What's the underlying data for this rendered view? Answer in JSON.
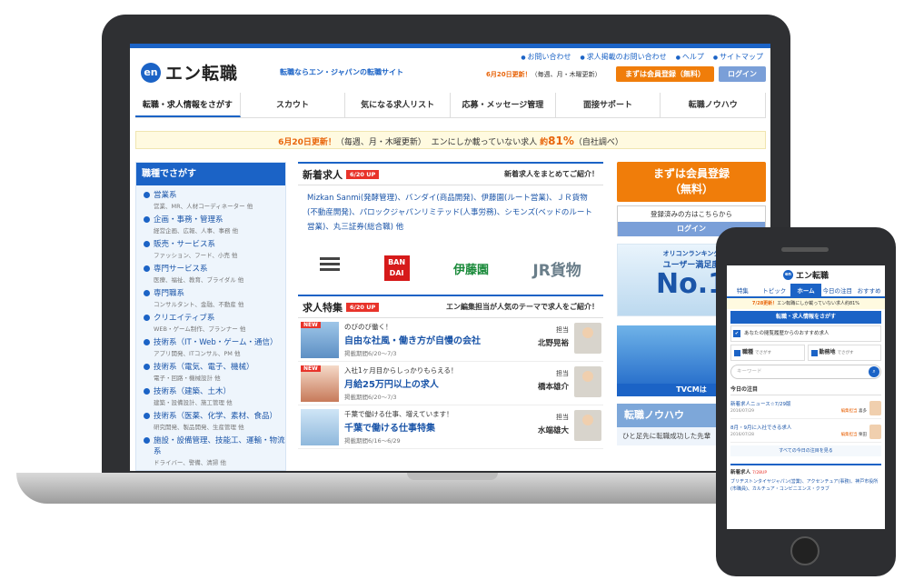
{
  "site": {
    "logo_badge": "en",
    "logo_word": "エン転職",
    "tagline": "転職ならエン・ジャパンの転職サイト",
    "toplinks": [
      "お問い合わせ",
      "求人掲載のお問い合わせ",
      "ヘルプ",
      "サイトマップ"
    ],
    "update_highlight": "6月20日更新！",
    "update_schedule": "（毎週、月・木曜更新）",
    "register_label": "まずは会員登録（無料）",
    "login_label": "ログイン"
  },
  "nav": [
    "転職・求人情報をさがす",
    "スカウト",
    "気になる求人リスト",
    "応募・メッセージ管理",
    "面接サポート",
    "転職ノウハウ"
  ],
  "notice": {
    "highlight": "6月20日更新！",
    "schedule": "（毎週、月・木曜更新）",
    "text": "エンにしか載っていない求人",
    "pct_label": "約",
    "pct": "81%",
    "source": "（自社調べ）"
  },
  "sidebar": {
    "title": "職種でさがす",
    "categories": [
      {
        "t": "営業系",
        "s": "営業、MR、人材コーディネーター 他"
      },
      {
        "t": "企画・事務・管理系",
        "s": "経営企画、広報、人事、事務 他"
      },
      {
        "t": "販売・サービス系",
        "s": "ファッション、フード、小売 他"
      },
      {
        "t": "専門サービス系",
        "s": "医療、福祉、教育、ブライダル 他"
      },
      {
        "t": "専門職系",
        "s": "コンサルタント、金融、不動産 他"
      },
      {
        "t": "クリエイティブ系",
        "s": "WEB・ゲーム制作、プランナー 他"
      },
      {
        "t": "技術系（IT・Web・ゲーム・通信）",
        "s": "アプリ開発、ITコンサル、PM 他"
      },
      {
        "t": "技術系（電気、電子、機械）",
        "s": "電子・回路・機械設計 他"
      },
      {
        "t": "技術系（建築、土木）",
        "s": "建築・設備設計、施工管理 他"
      },
      {
        "t": "技術系（医薬、化学、素材、食品）",
        "s": "研究開発、製品開発、生産管理 他"
      },
      {
        "t": "施設・設備管理、技能工、運輸・物流系",
        "s": "ドライバー、警備、清掃 他"
      }
    ]
  },
  "new_jobs": {
    "title": "新着求人",
    "tag": "6/20 UP",
    "right": "新着求人をまとめてご紹介！",
    "text": "Mizkan Sanmi(発酵管理)、バンダイ(商品開発)、伊藤園(ルート営業)、ＪＲ貨物(不動産開発)、パロックジャパンリミテッド(人事労務)、シモンズ(ベッドのルート営業)、丸三証券(総合職) 他",
    "brand_bandai": "BAN DAI",
    "brand_itoen": "伊藤園",
    "brand_jr": "JR貨物"
  },
  "features": {
    "title": "求人特集",
    "tag": "6/20 UP",
    "right": "エン編集担当が人気のテーマで求人をご紹介！",
    "staff_label": "担当",
    "new_badge": "NEW",
    "items": [
      {
        "sub": "のびのび働く！",
        "title": "自由な社風・働き方が自慢の会社",
        "period": "掲載期間6/20〜7/3",
        "staff": "北野晃裕",
        "new": true
      },
      {
        "sub": "入社1ヶ月目からしっかりもらえる！",
        "title": "月給25万円以上の求人",
        "period": "掲載期間6/20〜7/3",
        "staff": "橋本雄介",
        "new": true
      },
      {
        "sub": "千葉で働ける仕事、増えています！",
        "title": "千葉で働ける仕事特集",
        "period": "掲載期間6/16〜6/29",
        "staff": "水端雄大",
        "new": false
      }
    ]
  },
  "right": {
    "register_line1": "まずは会員登録",
    "register_line2": "（無料）",
    "login_prompt": "登録済みの方はこちらから",
    "login_label": "ログイン",
    "rank_a": "オリコンランキング",
    "rank_b": "ユーザー満足度",
    "rank_c": "No.1",
    "tvcm": "TVCMは",
    "knowhow": "転職ノウハウ",
    "knowhow_sub": "ひと足先に転職成功した先輩"
  },
  "phone": {
    "logo": "エン転職",
    "tabs": [
      "特集",
      "トピック",
      "ホーム",
      "今日の注目",
      "おすすめ"
    ],
    "notice_hl": "7/28更新！",
    "notice": "エン転職にしか載っていない求人約81%",
    "search_title": "転職・求人情報をさがす",
    "recommend": "あなたの閲覧履歴からのおすすめ求人",
    "btn1": "職種",
    "btn1_sub": "でさがす",
    "btn2": "勤務地",
    "btn2_sub": "でさがす",
    "search_placeholder": "キーワード",
    "today_title": "今日の注目",
    "today_items": [
      {
        "a": "新着求人ニュース☆7/29版",
        "b": "2016/07/29",
        "c_label": "編集担当",
        "c": "喜多"
      },
      {
        "a": "8月・9月に入社できる求人",
        "b": "2016/07/28",
        "c_label": "編集担当",
        "c": "栗田"
      }
    ],
    "more": "すべての今日の注目を見る",
    "new_title": "新着求人",
    "new_tag": "7/28UP",
    "new_text": "ブリヂストンタイヤジャパン(営業)、アクセンチュア(事務)、神戸市役所(市職員)、カルチュア・コンビニエンス・クラブ"
  }
}
